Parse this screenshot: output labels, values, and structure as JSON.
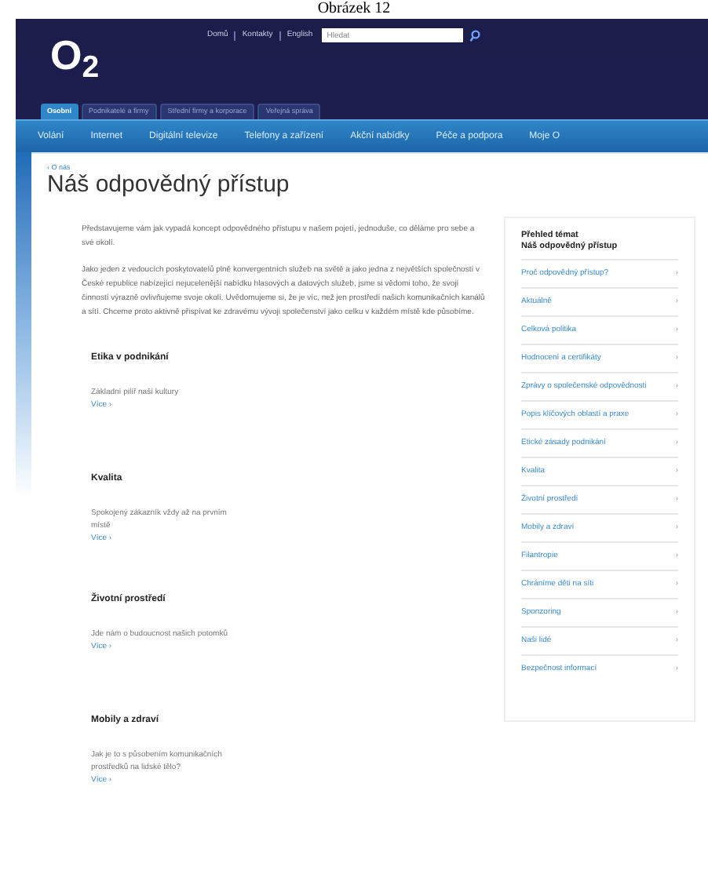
{
  "caption": "Obrázek 12",
  "logo": "O$_{2}$",
  "top_links": [
    "Domů",
    "Kontakty",
    "English"
  ],
  "search": {
    "placeholder": "Hledat"
  },
  "segment_tabs": [
    {
      "label": "Osobní",
      "selected": true
    },
    {
      "label": "Podnikatelé a firmy",
      "selected": false
    },
    {
      "label": "Střední firmy a korporace",
      "selected": false
    },
    {
      "label": "Veřejná správa",
      "selected": false
    }
  ],
  "nav": [
    "Volání",
    "Internet",
    "Digitální televize",
    "Telefony a zařízení",
    "Akční nabídky",
    "Péče a podpora",
    "Moje O"
  ],
  "breadcrumb": "‹ O nás",
  "title": "Náš odpovědný přístup",
  "paragraphs": [
    "Představujeme vám jak vypadá koncept odpovědného přístupu v našem pojetí, jednoduše, co děláme pro sebe a své okolí.",
    "Jako jeden z vedoucích poskytovatelů plně konvergentních služeb na světě a jako jedna z největších společností v České republice nabízející nejucelenější nabídku hlasových a datových služeb, jsme si vědomi toho, že svojí činností výrazně ovlivňujeme svoje okolí. Uvědomujeme si, že je víc, než jen prostředí našich komunikačních kanálů a sítí. Chceme proto aktivně přispívat ke zdravému vývoji společenství jako celku v každém místě kde působíme."
  ],
  "sections": [
    {
      "heading": "Etika v podnikání",
      "text": "Základní pilíř naší kultury",
      "link": "Více ›"
    },
    {
      "heading": "Kvalita",
      "text": "Spokojený zákazník vždy až na prvním místě",
      "link": "Více ›"
    },
    {
      "heading": "Životní prostředí",
      "text": "Jde nám o budoucnost našich potomků",
      "link": "Více ›"
    },
    {
      "heading": "Mobily a zdraví",
      "text": "Jak je to s působením komunikačních prostředků na lidské tělo?",
      "link": "Více ›"
    }
  ],
  "sidebar": {
    "title": "Přehled témat",
    "subtitle": "Náš odpovědný přístup",
    "items": [
      "Proč odpovědný přístup?",
      "Aktuálně",
      "Celková politika",
      "Hodnocení a certifikáty",
      "Zprávy o společenské odpovědnosti",
      "Popis klíčových oblastí a praxe",
      "Etické zásady podnikání",
      "Kvalita",
      "Životní prostředí",
      "Mobily a zdraví",
      "Filantropie",
      "Chráníme děti na síti",
      "Sponzoring",
      "Naši lidé",
      "Bezpečnost informací"
    ],
    "arrow": "›"
  }
}
